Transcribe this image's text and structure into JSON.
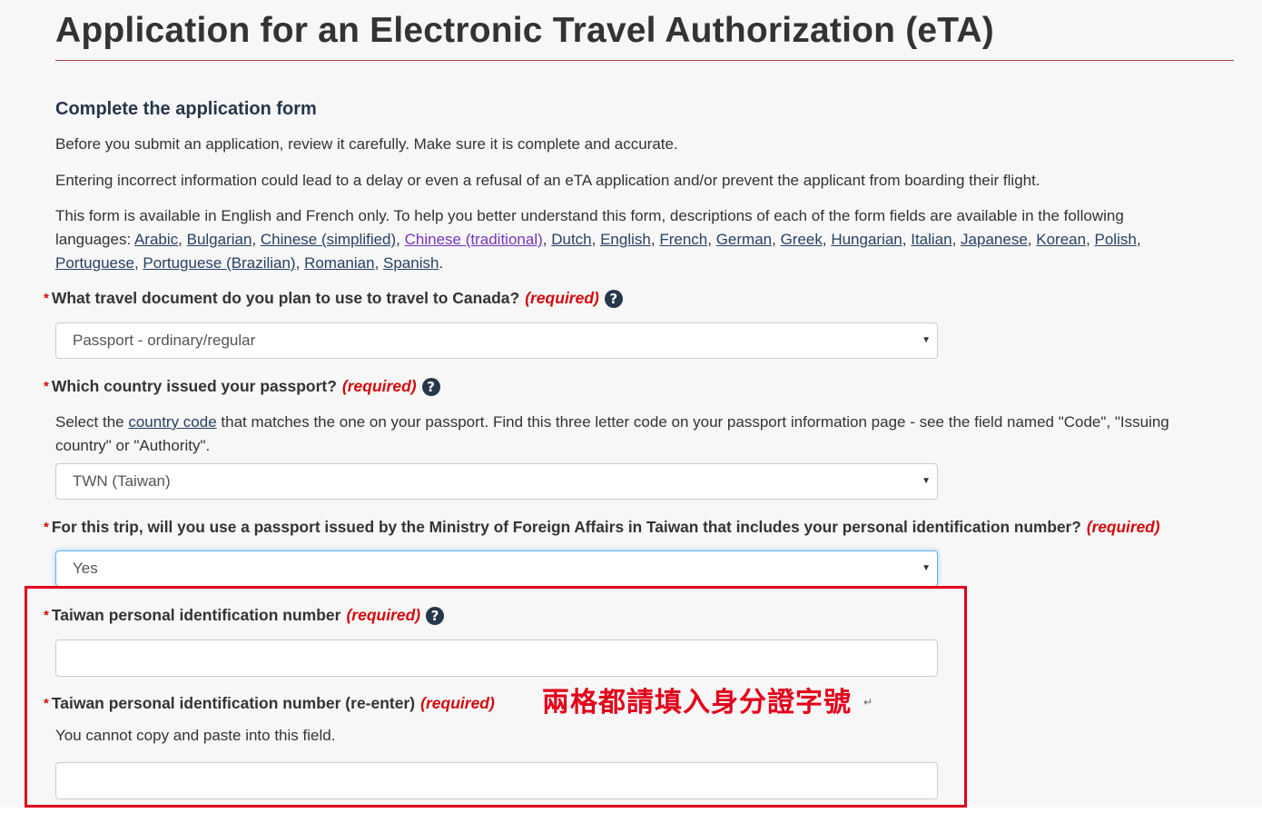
{
  "page": {
    "title": "Application for an Electronic Travel Authorization (eTA)",
    "section_heading": "Complete the application form",
    "intro_1": "Before you submit an application, review it carefully. Make sure it is complete and accurate.",
    "intro_2": "Entering incorrect information could lead to a delay or even a refusal of an eTA application and/or prevent the applicant from boarding their flight.",
    "intro_3_prefix": "This form is available in English and French only. To help you better understand this form, descriptions of each of the form fields are available in the following languages: ",
    "languages": [
      "Arabic",
      "Bulgarian",
      "Chinese (simplified)",
      "Chinese (traditional)",
      "Dutch",
      "English",
      "French",
      "German",
      "Greek",
      "Hungarian",
      "Italian",
      "Japanese",
      "Korean",
      "Polish",
      "Portuguese",
      "Portuguese (Brazilian)",
      "Romanian",
      "Spanish"
    ]
  },
  "required_marker": "*",
  "required_text": "(required)",
  "help_symbol": "?",
  "caret_symbol": "▼",
  "fields": {
    "travel_document": {
      "label": "What travel document do you plan to use to travel to Canada?",
      "value": "Passport - ordinary/regular"
    },
    "passport_country": {
      "label": "Which country issued your passport?",
      "hint_prefix": "Select the ",
      "hint_link": "country code",
      "hint_suffix": " that matches the one on your passport.  Find this three letter code on your passport information page - see the field named \"Code\", \"Issuing country\" or \"Authority\".",
      "value": "TWN (Taiwan)"
    },
    "taiwan_passport": {
      "label": "For this trip, will you use a passport issued by the Ministry of Foreign Affairs in Taiwan that includes your personal identification number?",
      "value": "Yes"
    },
    "taiwan_id": {
      "label": "Taiwan personal identification number",
      "value": ""
    },
    "taiwan_id_reenter": {
      "label": "Taiwan personal identification number (re-enter)",
      "hint": "You cannot copy and paste into this field.",
      "value": ""
    }
  },
  "annotation": {
    "text": "兩格都請填入身分證字號",
    "mark": "↵",
    "color": "#e3001b"
  },
  "colors": {
    "accent_rule": "#af3c43",
    "heading": "#26374a",
    "required": "#d3080c",
    "link": "#284162",
    "visited_link": "#7834bc"
  }
}
